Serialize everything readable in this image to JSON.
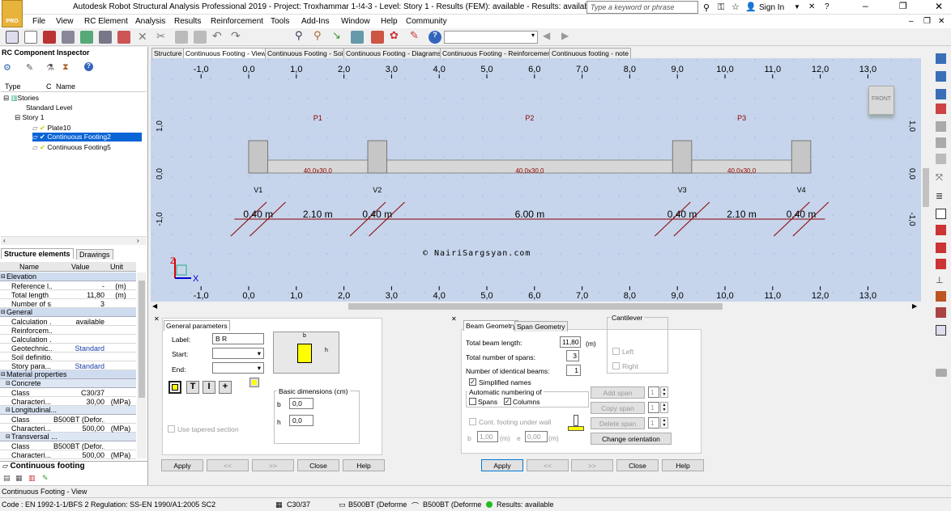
{
  "window": {
    "title": "Autodesk Robot Structural Analysis Professional 2019 - Project: Troxhammar 1-!4-3 - Level: Story 1 - Results (FEM): available - Results: available",
    "search_placeholder": "Type a keyword or phrase",
    "sign_in": "Sign In"
  },
  "menu": [
    "File",
    "View",
    "RC Element",
    "Analysis",
    "Results",
    "Reinforcement",
    "Tools",
    "Add-Ins",
    "Window",
    "Help",
    "Community"
  ],
  "inspector": {
    "title": "RC Component Inspector",
    "col_type": "Type",
    "col_c": "C",
    "col_name": "Name",
    "tree": [
      {
        "label": "Stories",
        "level": 0
      },
      {
        "label": "Standard Level",
        "level": 1
      },
      {
        "label": "Story 1",
        "level": 1
      },
      {
        "label": "Plate10",
        "level": 2
      },
      {
        "label": "Continuous Footing2",
        "level": 2,
        "selected": true
      },
      {
        "label": "Continuous Footing5",
        "level": 2
      }
    ],
    "tab_structure": "Structure elements",
    "tab_drawings": "Drawings"
  },
  "props": {
    "col_name": "Name",
    "col_value": "Value",
    "col_unit": "Unit",
    "rows": [
      {
        "type": "hdr",
        "name": "Elevation"
      },
      {
        "name": "Reference l...",
        "value": "-",
        "unit": "(m)"
      },
      {
        "name": "Total length",
        "value": "11,80",
        "unit": "(m)"
      },
      {
        "name": "Number of s...",
        "value": "3",
        "unit": ""
      },
      {
        "type": "hdr",
        "name": "General"
      },
      {
        "name": "Calculation ...",
        "value": "available",
        "unit": ""
      },
      {
        "name": "Reinforcem...",
        "value": "",
        "unit": ""
      },
      {
        "name": "Calculation ...",
        "value": "",
        "unit": ""
      },
      {
        "name": "Geotechnic...",
        "value": "Standard",
        "unit": ""
      },
      {
        "name": "Soil definitio...",
        "value": "",
        "unit": ""
      },
      {
        "name": "Story para...",
        "value": "Standard",
        "unit": ""
      },
      {
        "type": "hdr",
        "name": "Material properties"
      },
      {
        "type": "sub",
        "name": "Concrete"
      },
      {
        "name": "Class",
        "value": "C30/37",
        "unit": ""
      },
      {
        "name": "Characteri...",
        "value": "30,00",
        "unit": "(MPa)"
      },
      {
        "type": "sub",
        "name": "Longitudinal..."
      },
      {
        "name": "Class",
        "value": "B500BT (Defor...",
        "unit": ""
      },
      {
        "name": "Characteri...",
        "value": "500,00",
        "unit": "(MPa)"
      },
      {
        "type": "sub",
        "name": "Transversal ..."
      },
      {
        "name": "Class",
        "value": "B500BT (Defor...",
        "unit": ""
      },
      {
        "name": "Characteri...",
        "value": "500,00",
        "unit": "(MPa)"
      }
    ],
    "footer_title": "Continuous footing"
  },
  "doc_tabs": [
    "Structure",
    "Continuous Footing - View",
    "Continuous Footing - Soil",
    "Continuous Footing - Diagrams",
    "Continuous Footing - Reinforcement",
    "Continuous footing - note"
  ],
  "drawing": {
    "axis_ticks": [
      "-1,0",
      "0,0",
      "1,0",
      "2,0",
      "3,0",
      "4,0",
      "5,0",
      "6,0",
      "7,0",
      "8,0",
      "9,0",
      "10,0",
      "11,0",
      "12,0",
      "13,0"
    ],
    "v_ticks": [
      "1,0",
      "0,0",
      "-1,0"
    ],
    "spans": [
      "P1",
      "P2",
      "P3"
    ],
    "span_sections": [
      "40,0x30,0",
      "40,0x30,0",
      "40,0x30,0"
    ],
    "supports": [
      "V1",
      "V2",
      "V3",
      "V4"
    ],
    "dims": [
      "0.40 m",
      "2.10 m",
      "0.40 m",
      "6.00 m",
      "0.40 m",
      "2.10 m",
      "0.40 m"
    ],
    "watermark": "© NairiSargsyan.com",
    "viewcube": "FRONT",
    "axis_z": "Z",
    "axis_x": "X"
  },
  "general_params": {
    "title": "General parameters",
    "label_label": "Label:",
    "label_value": "B R",
    "start_label": "Start:",
    "end_label": "End:",
    "section_b": "b",
    "section_h": "h",
    "basic_dims_title": "Basic dimensions (cm)",
    "b_label": "b",
    "b_value": "0,0",
    "h_label": "h",
    "h_value": "0,0",
    "tapered": "Use tapered section",
    "buttons": [
      "Apply",
      "<<",
      ">>",
      "Close",
      "Help"
    ]
  },
  "beam_geometry": {
    "tab1": "Beam Geometry",
    "tab2": "Span Geometry",
    "total_length_label": "Total beam length:",
    "total_length_value": "11,80",
    "total_length_unit": "(m)",
    "num_spans_label": "Total number of spans:",
    "num_spans_value": "3",
    "num_beams_label": "Number of identical beams:",
    "num_beams_value": "1",
    "simplified": "Simplified names",
    "auto_num": "Automatic numbering of",
    "spans": "Spans",
    "columns": "Columns",
    "cantilever": "Cantilever",
    "left": "Left",
    "right": "Right",
    "add_span": "Add span",
    "copy_span": "Copy span",
    "delete_span": "Delete span",
    "spin_val": "1",
    "change_orientation": "Change orientation",
    "wall_footing": "Cont. footing under wall",
    "b_lbl": "b",
    "b_val": "1,00",
    "e_lbl": "e",
    "e_val": "0,00",
    "unit_m": "(m)",
    "buttons": [
      "Apply",
      "<<",
      ">>",
      "Close",
      "Help"
    ]
  },
  "status": {
    "view_name": "Continuous Footing - View",
    "code": "Code : EN 1992-1-1/BFS 2  Regulation: SS-EN 1990/A1:2005 SC2",
    "concrete": "C30/37",
    "steel1": "B500BT (Deforme",
    "steel2": "B500BT (Deforme",
    "results": "Results: available"
  }
}
